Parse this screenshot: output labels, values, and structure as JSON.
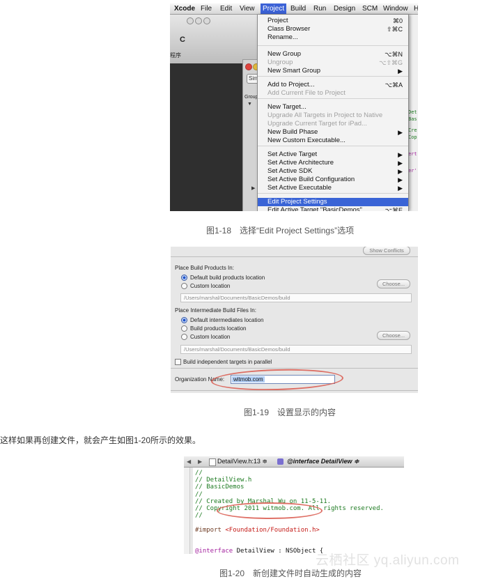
{
  "fig18": {
    "menubar": [
      "Xcode",
      "File",
      "Edit",
      "View",
      "Project",
      "Build",
      "Run",
      "Design",
      "SCM",
      "Window",
      "H"
    ],
    "active_menu": "Project",
    "left_window_text": "程序",
    "left_window_glyph": "C",
    "inner_window_button": "Sim",
    "inner_window_group": "Group",
    "right_code_lines": [
      " Det",
      " Bas",
      " Cre",
      " Cop",
      " ert",
      " er'"
    ],
    "menu_items": [
      {
        "label": "Project",
        "shortcut": "⌘0",
        "disabled": false
      },
      {
        "label": "Class Browser",
        "shortcut": "⇧⌘C",
        "disabled": false
      },
      {
        "label": "Rename...",
        "shortcut": "",
        "disabled": false
      },
      {
        "label": "New Group",
        "shortcut": "⌥⌘N",
        "disabled": false
      },
      {
        "label": "Ungroup",
        "shortcut": "⌥⇧⌘G",
        "disabled": true
      },
      {
        "label": "New Smart Group",
        "shortcut": "▶",
        "disabled": false
      },
      {
        "label": "Add to Project...",
        "shortcut": "⌥⌘A",
        "disabled": false
      },
      {
        "label": "Add Current File to Project",
        "shortcut": "",
        "disabled": true
      },
      {
        "label": "New Target...",
        "shortcut": "",
        "disabled": false
      },
      {
        "label": "Upgrade All Targets in Project to Native",
        "shortcut": "",
        "disabled": true
      },
      {
        "label": "Upgrade Current Target for iPad...",
        "shortcut": "",
        "disabled": true
      },
      {
        "label": "New Build Phase",
        "shortcut": "▶",
        "disabled": false
      },
      {
        "label": "New Custom Executable...",
        "shortcut": "",
        "disabled": false
      },
      {
        "label": "Set Active Target",
        "shortcut": "▶",
        "disabled": false
      },
      {
        "label": "Set Active Architecture",
        "shortcut": "▶",
        "disabled": false
      },
      {
        "label": "Set Active SDK",
        "shortcut": "▶",
        "disabled": false
      },
      {
        "label": "Set Active Build Configuration",
        "shortcut": "▶",
        "disabled": false
      },
      {
        "label": "Set Active Executable",
        "shortcut": "▶",
        "disabled": false
      },
      {
        "label": "Edit Project Settings",
        "shortcut": "",
        "disabled": false,
        "selected": true
      },
      {
        "label": "Edit Active Target \"BasicDemos\"",
        "shortcut": "⌥⌘E",
        "disabled": false
      }
    ],
    "caption": "图1-18　选择“Edit Project Settings”选项"
  },
  "fig19": {
    "show_conflicts": "Show Conflicts",
    "build_products_heading": "Place Build Products In:",
    "build_products_options": [
      "Default build products location",
      "Custom location"
    ],
    "build_products_selected": 0,
    "choose_label": "Choose...",
    "build_products_path": "/Users/marshal/Documents/BasicDemos/build",
    "intermediate_heading": "Place Intermediate Build Files In:",
    "intermediate_options": [
      "Default intermediates location",
      "Build products location",
      "Custom location"
    ],
    "intermediate_selected": 0,
    "intermediate_path": "/Users/marshal/Documents/BasicDemos/build",
    "parallel_label": "Build independent targets in parallel",
    "parallel_checked": false,
    "org_label": "Organization Name:",
    "org_value": "witmob.com",
    "caption": "图1-19　设置显示的内容"
  },
  "paragraph": "这样如果再创建文件，就会产生如图1-20所示的效果。",
  "fig20": {
    "nav_back": "◀",
    "nav_forward": "▶",
    "file_label": "DetailView.h:13 ≑",
    "symbol_label": "@interface DetailView ≑",
    "code_lines": [
      {
        "type": "cmt",
        "text": "//"
      },
      {
        "type": "cmt",
        "text": "//  DetailView.h"
      },
      {
        "type": "cmt",
        "text": "//  BasicDemos"
      },
      {
        "type": "cmt",
        "text": "//"
      },
      {
        "type": "cmt",
        "text": "//  Created by Marshal Wu on 11-5-11."
      },
      {
        "type": "cmt",
        "text": "//  Copyright 2011 witmob.com. All rights reserved."
      },
      {
        "type": "cmt",
        "text": "//"
      },
      {
        "type": "blank",
        "text": ""
      },
      {
        "type": "pp",
        "text": "#import ",
        "str": "<Foundation/Foundation.h>"
      },
      {
        "type": "blank",
        "text": ""
      },
      {
        "type": "blank",
        "text": ""
      },
      {
        "type": "code",
        "kw": "@interface",
        "text": " DetailView : NSObject {"
      }
    ],
    "caption": "图1-20　新创建文件时自动生成的内容"
  },
  "watermark": "云栖社区 yq.aliyun.com"
}
